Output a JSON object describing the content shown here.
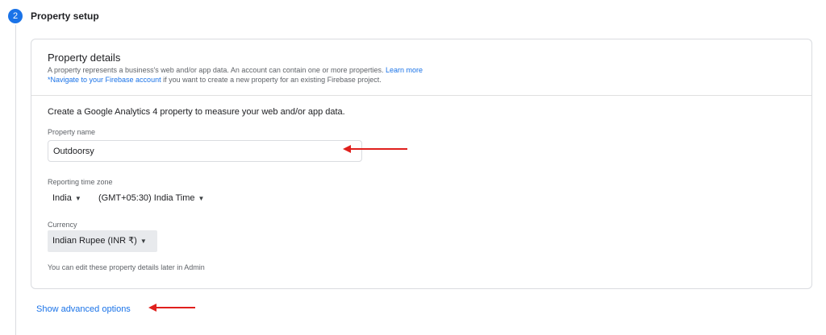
{
  "step": {
    "number": "2",
    "title": "Property setup"
  },
  "details": {
    "title": "Property details",
    "description": "A property represents a business's web and/or app data. An account can contain one or more properties.",
    "learn_more": "Learn more",
    "firebase_link": "*Navigate to your Firebase account",
    "firebase_text": " if you want to create a new property for an existing Firebase project."
  },
  "form": {
    "intro": "Create a Google Analytics 4 property to measure your web and/or app data.",
    "property_name_label": "Property name",
    "property_name_value": "Outdoorsy",
    "timezone_label": "Reporting time zone",
    "country": "India",
    "timezone": "(GMT+05:30) India Time",
    "currency_label": "Currency",
    "currency": "Indian Rupee (INR ₹)",
    "note": "You can edit these property details later in Admin"
  },
  "advanced": {
    "label": "Show advanced options"
  },
  "colors": {
    "accent": "#1a73e8",
    "annotation_arrow": "#e0201d"
  },
  "icons": {
    "caret": "caret-down-icon",
    "arrow": "red-arrow-annotation"
  }
}
